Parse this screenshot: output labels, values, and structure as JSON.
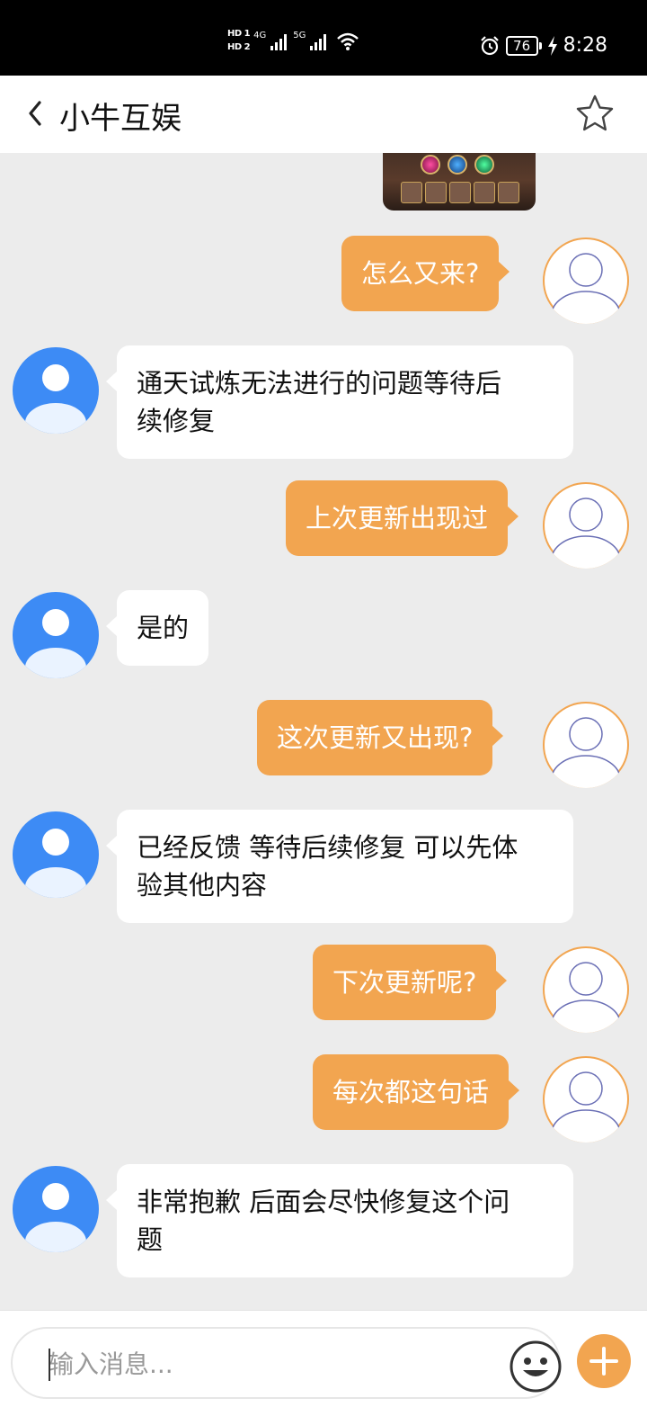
{
  "status_bar": {
    "sim1": "HD 1",
    "sim2": "HD 2",
    "net1": "4G",
    "net2": "5G",
    "battery": "76",
    "time": "8:28",
    "icons": [
      "signal-icon",
      "wifi-icon",
      "alarm-icon",
      "battery-icon",
      "charging-icon"
    ]
  },
  "header": {
    "title": "小牛互娱",
    "back_icon": "chevron-left-icon",
    "favorite_icon": "star-icon"
  },
  "messages": [
    {
      "sender": "me",
      "text": "怎么又来?"
    },
    {
      "sender": "them",
      "text": "通天试炼无法进行的问题等待后\n续修复"
    },
    {
      "sender": "me",
      "text": "上次更新出现过"
    },
    {
      "sender": "them",
      "text": "是的"
    },
    {
      "sender": "me",
      "text": "这次更新又出现?"
    },
    {
      "sender": "them",
      "text": "已经反馈 等待后续修复 可以先体\n验其他内容"
    },
    {
      "sender": "me",
      "text": "下次更新呢?"
    },
    {
      "sender": "me",
      "text": "每次都这句话"
    },
    {
      "sender": "them",
      "text": "非常抱歉 后面会尽快修复这个问\n题"
    }
  ],
  "input": {
    "placeholder": "输入消息...",
    "emoji_icon": "emoji-icon",
    "add_icon": "plus-icon"
  },
  "colors": {
    "accent": "#f2a550",
    "agent_avatar": "#3d8bf5",
    "chat_bg": "#ececec"
  }
}
